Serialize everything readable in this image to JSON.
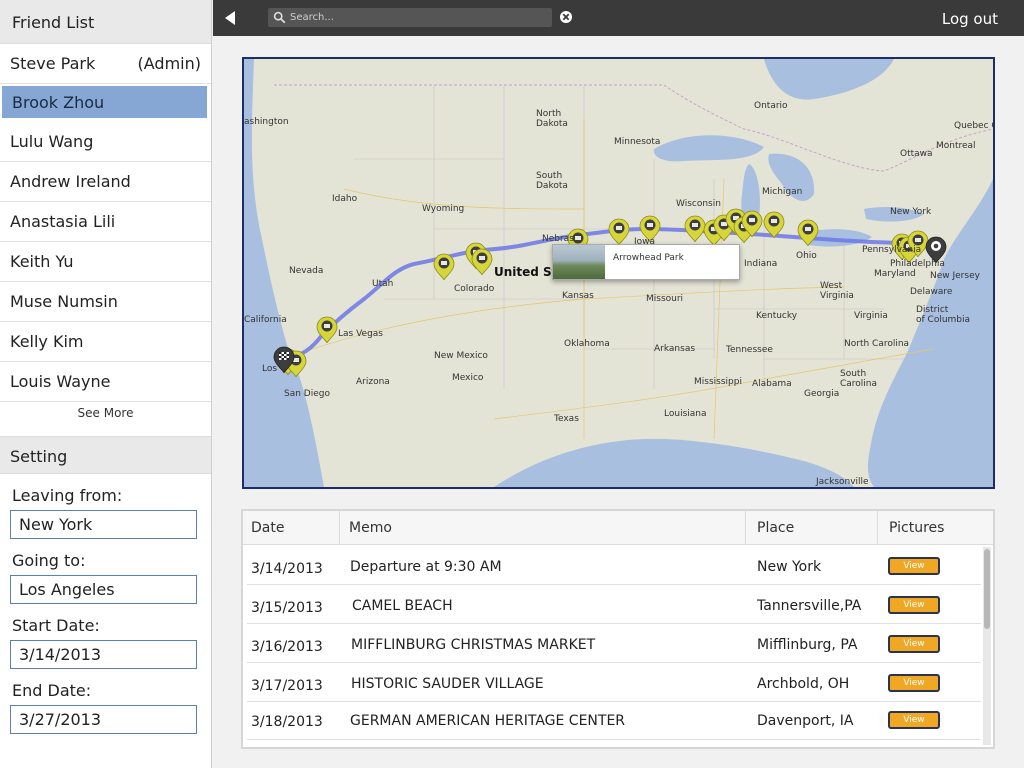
{
  "sidebar": {
    "friend_list_title": "Friend List",
    "friends": [
      {
        "name": "Steve Park",
        "tag": "(Admin)"
      },
      {
        "name": "Brook Zhou",
        "tag": ""
      },
      {
        "name": "Lulu Wang",
        "tag": ""
      },
      {
        "name": "Andrew Ireland",
        "tag": ""
      },
      {
        "name": "Anastasia Lili",
        "tag": ""
      },
      {
        "name": "Keith Yu",
        "tag": ""
      },
      {
        "name": "Muse Numsin",
        "tag": ""
      },
      {
        "name": "Kelly Kim",
        "tag": ""
      },
      {
        "name": "Louis Wayne",
        "tag": ""
      }
    ],
    "selected_friend": "Brook Zhou",
    "see_more": "See More",
    "setting_title": "Setting",
    "leaving_label": "Leaving from:",
    "leaving_value": "New York",
    "going_label": "Going to:",
    "going_value": "Los Angeles",
    "start_label": "Start Date:",
    "start_value": "3/14/2013",
    "end_label": "End Date:",
    "end_value": "3/27/2013"
  },
  "topbar": {
    "search_placeholder": "Search...",
    "logout": "Log out"
  },
  "map": {
    "labels": {
      "washington": "ashington",
      "north_dakota": "North\nDakota",
      "south_dakota": "South\nDakota",
      "minnesota": "Minnesota",
      "wisconsin": "Wisconsin",
      "michigan": "Michigan",
      "ontario": "Ontario",
      "quebec": "Quebec City",
      "ottawa": "Ottawa",
      "montreal": "Montreal",
      "idaho": "Idaho",
      "wyoming": "Wyoming",
      "nebraska": "Nebras",
      "iowa": "Iowa",
      "nevada": "Nevada",
      "utah": "Utah",
      "colorado": "Colorado",
      "united_states": "United Sta",
      "kansas": "Kansas",
      "missouri": "Missouri",
      "indiana": "Indiana",
      "ohio": "Ohio",
      "new_york": "New York",
      "pennsylvania": "Pennsylvania",
      "philadelphia": "Philadelphia",
      "maryland": "Maryland",
      "new_jersey": "New Jersey",
      "delaware": "Delaware",
      "washington_dc": "District\nof Columbia",
      "west_virginia": "West\nVirginia",
      "virginia": "Virginia",
      "kentucky": "Kentucky",
      "tennessee": "Tennessee",
      "north_carolina": "North Carolina",
      "south_carolina": "South\nCarolina",
      "california": "California",
      "las_vegas": "Las Vegas",
      "los_angeles": "Los",
      "san_diego": "San Diego",
      "arizona": "Arizona",
      "new_mexico": "New Mexico",
      "oklahoma": "Oklahoma",
      "arkansas": "Arkansas",
      "mississippi": "Mississippi",
      "alabama": "Alabama",
      "georgia": "Georgia",
      "texas": "Texas",
      "louisiana": "Louisiana",
      "mexico": "Mexico",
      "jacksonville": "Jacksonville"
    },
    "popup_title": "Arrowhead Park",
    "colors": {
      "route": "#6c78e6",
      "pin": "#d6d63a",
      "water": "#a9bfe0",
      "land": "#e4e4d6"
    }
  },
  "table": {
    "headers": {
      "date": "Date",
      "memo": "Memo",
      "place": "Place",
      "pictures": "Pictures"
    },
    "view_label": "View",
    "rows": [
      {
        "date": "3/14/2013",
        "memo": "Departure at 9:30 AM",
        "place": "New York"
      },
      {
        "date": "3/15/2013",
        "memo": "CAMEL BEACH",
        "place": "Tannersville,PA"
      },
      {
        "date": "3/16/2013",
        "memo": "MIFFLINBURG CHRISTMAS MARKET",
        "place": "Mifflinburg, PA"
      },
      {
        "date": "3/17/2013",
        "memo": "HISTORIC SAUDER VILLAGE",
        "place": "Archbold, OH"
      },
      {
        "date": "3/18/2013",
        "memo": "GERMAN AMERICAN HERITAGE CENTER",
        "place": "Davenport, IA"
      }
    ]
  }
}
